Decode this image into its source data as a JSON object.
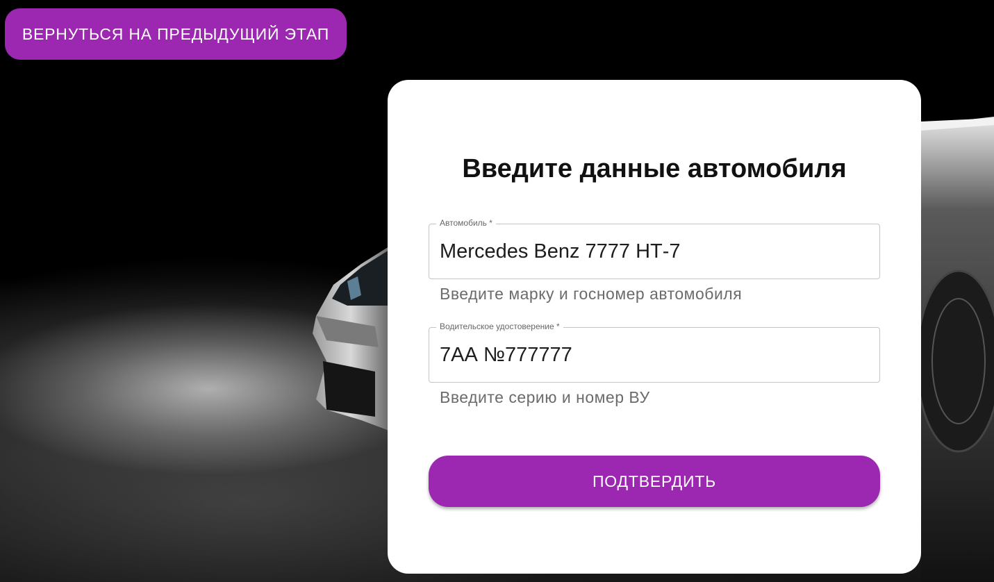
{
  "nav": {
    "back_label": "ВЕРНУТЬСЯ НА ПРЕДЫДУЩИЙ ЭТАП"
  },
  "form": {
    "title": "Введите данные автомобиля",
    "car_field": {
      "label": "Автомобиль *",
      "value": "Mercedes Benz 7777 НТ-7",
      "helper": "Введите марку и госномер автомобиля"
    },
    "license_field": {
      "label": "Водительское удостоверение *",
      "value": "7АА №777777",
      "helper": "Введите серию и номер ВУ"
    },
    "submit_label": "ПОДТВЕРДИТЬ"
  },
  "colors": {
    "accent": "#9c27b0",
    "card_bg": "#ffffff",
    "page_bg": "#000000"
  }
}
